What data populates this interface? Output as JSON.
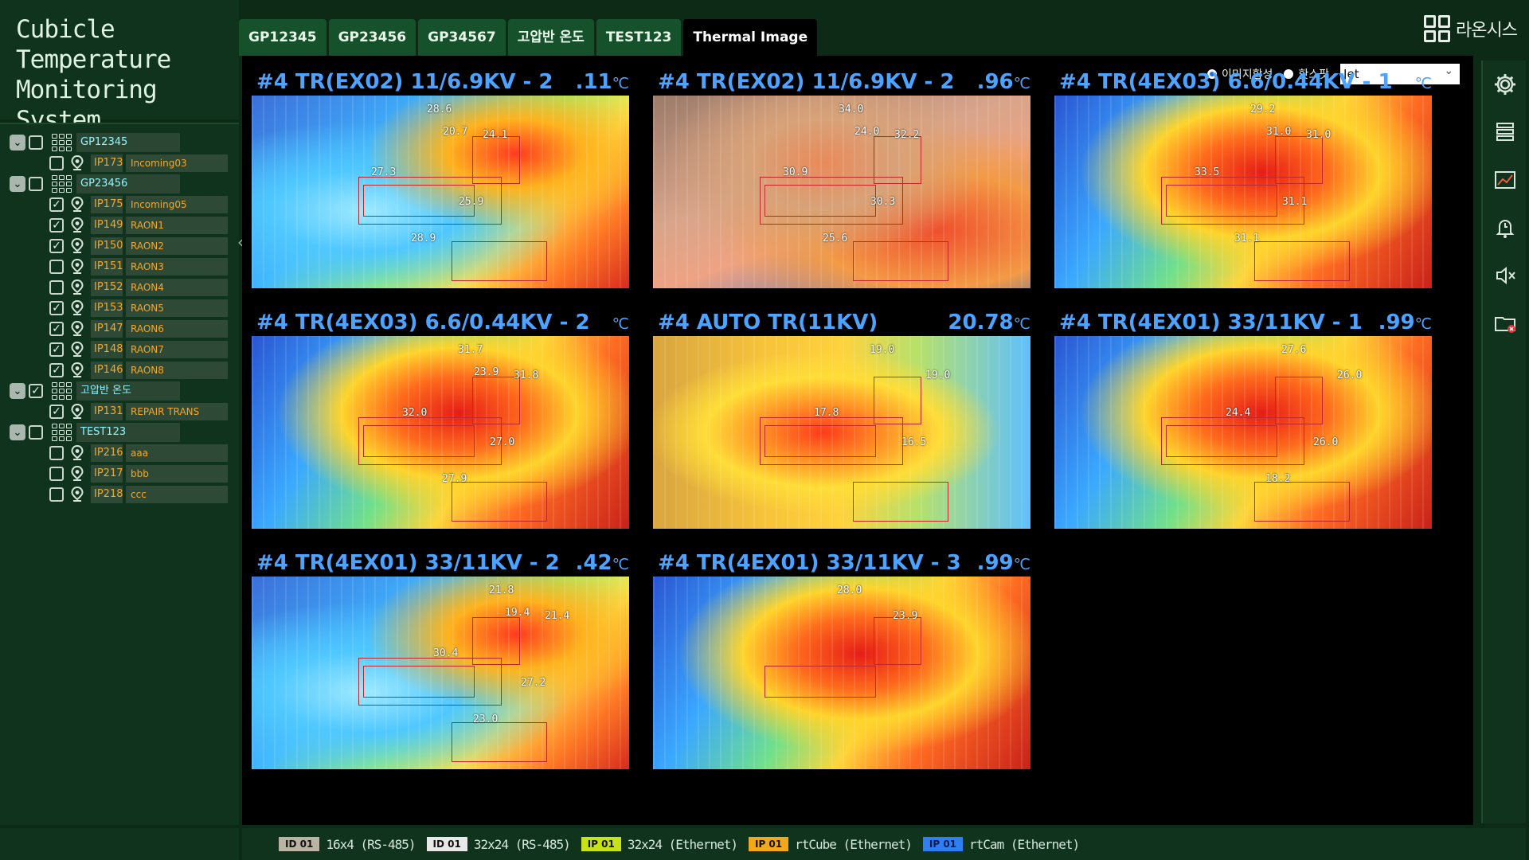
{
  "app": {
    "title_lines": [
      "Cubicle",
      "Temperature",
      "Monitoring System"
    ]
  },
  "tabs": [
    {
      "label": "GP12345",
      "active": false
    },
    {
      "label": "GP23456",
      "active": false
    },
    {
      "label": "GP34567",
      "active": false
    },
    {
      "label": "고압반 온도",
      "active": false
    },
    {
      "label": "TEST123",
      "active": false
    },
    {
      "label": "Thermal Image",
      "active": true
    }
  ],
  "logo": {
    "text": "라온시스"
  },
  "controls": {
    "radio_image": "이미지합성",
    "radio_hotspot": "핫스팟",
    "colormap_value": "Jet"
  },
  "tree": [
    {
      "type": "group",
      "label": "GP12345",
      "checked": false,
      "devices": [
        {
          "id": "IP173",
          "name": "Incoming03",
          "checked": false
        }
      ]
    },
    {
      "type": "group",
      "label": "GP23456",
      "checked": false,
      "devices": [
        {
          "id": "IP175",
          "name": "Incoming05",
          "checked": true
        },
        {
          "id": "IP149",
          "name": "RAON1",
          "checked": true
        },
        {
          "id": "IP150",
          "name": "RAON2",
          "checked": true
        },
        {
          "id": "IP151",
          "name": "RAON3",
          "checked": false
        },
        {
          "id": "IP152",
          "name": "RAON4",
          "checked": false
        },
        {
          "id": "IP153",
          "name": "RAON5",
          "checked": true
        },
        {
          "id": "IP147",
          "name": "RAON6",
          "checked": true
        },
        {
          "id": "IP148",
          "name": "RAON7",
          "checked": true
        },
        {
          "id": "IP146",
          "name": "RAON8",
          "checked": true
        }
      ]
    },
    {
      "type": "group",
      "label": "고압반 온도",
      "checked": true,
      "devices": [
        {
          "id": "IP131",
          "name": "REPAIR TRANS",
          "checked": true
        }
      ]
    },
    {
      "type": "group",
      "label": "TEST123",
      "checked": false,
      "devices": [
        {
          "id": "IP216",
          "name": "aaa",
          "checked": false
        },
        {
          "id": "IP217",
          "name": "bbb",
          "checked": false
        },
        {
          "id": "IP218",
          "name": "ccc",
          "checked": false
        }
      ]
    }
  ],
  "cameras": [
    {
      "title": "#4 TR(EX02) 11/6.9KV - 2",
      "temp": ".11",
      "unit": "℃",
      "labels": [
        "28.6",
        "24.1",
        "27.3",
        "25.9",
        "28.9",
        "20.7"
      ],
      "palette": "cool"
    },
    {
      "title": "#4 TR(EX02) 11/6.9KV - 2",
      "temp": ".96",
      "unit": "℃",
      "labels": [
        "34.0",
        "32.2",
        "30.9",
        "30.3",
        "25.6",
        "24.0"
      ],
      "palette": "warm"
    },
    {
      "title": "#4 TR(4EX03) 6.6/0.44KV - 1",
      "temp": "",
      "unit": "℃",
      "labels": [
        "29.2",
        "31.0",
        "33.5",
        "31.1",
        "31.1",
        "31.0"
      ],
      "palette": "hot"
    },
    {
      "title": "#4 TR(4EX03) 6.6/0.44KV - 2",
      "temp": "",
      "unit": "℃",
      "labels": [
        "31.7",
        "31.8",
        "32.0",
        "27.0",
        "27.9",
        "23.9"
      ],
      "palette": "hot"
    },
    {
      "title": "#4 AUTO TR(11KV)",
      "temp": "20.78",
      "unit": "℃",
      "labels": [
        "19.0",
        "19.0",
        "17.8",
        "16.5"
      ],
      "palette": "mixed"
    },
    {
      "title": "#4 TR(4EX01) 33/11KV - 1",
      "temp": ".99",
      "unit": "℃",
      "labels": [
        "27.6",
        "26.0",
        "24.4",
        "26.0",
        "18.2"
      ],
      "palette": "hot"
    },
    {
      "title": "#4 TR(4EX01) 33/11KV - 2",
      "temp": ".42",
      "unit": "℃",
      "labels": [
        "21.8",
        "21.4",
        "30.4",
        "27.2",
        "23.0",
        "19.4"
      ],
      "palette": "cool"
    },
    {
      "title": "#4 TR(4EX01) 33/11KV - 3",
      "temp": ".99",
      "unit": "℃",
      "labels": [
        "28.0",
        "23.9"
      ],
      "palette": "hot"
    }
  ],
  "status": [
    {
      "badge": "ID 01",
      "text": "16x4 (RS-485)",
      "color": "#b8b3a2"
    },
    {
      "badge": "ID 01",
      "text": "32x24 (RS-485)",
      "color": "#e8e8e8"
    },
    {
      "badge": "IP 01",
      "text": "32x24 (Ethernet)",
      "color": "#c8e21a"
    },
    {
      "badge": "IP 01",
      "text": "rtCube (Ethernet)",
      "color": "#f2a81d"
    },
    {
      "badge": "IP 01",
      "text": "rtCam (Ethernet)",
      "color": "#2f7ff2"
    }
  ],
  "toolbar": [
    "gear-icon",
    "server-icon",
    "chart-icon",
    "alarm-bell-icon",
    "mute-icon",
    "folder-error-icon"
  ]
}
